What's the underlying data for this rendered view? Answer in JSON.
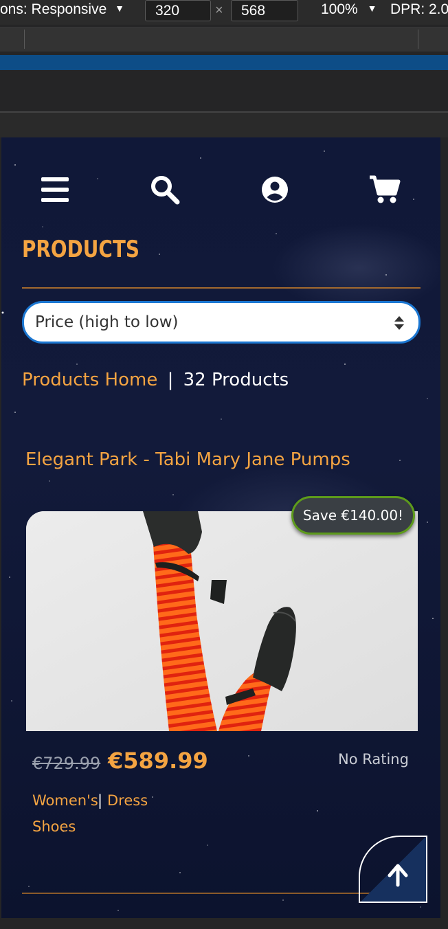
{
  "devtools": {
    "dimensions_label": "ons: Responsive",
    "width_value": "320",
    "height_value": "568",
    "times_symbol": "×",
    "zoom_label": "100%",
    "dpr_label": "DPR: 2.0"
  },
  "nav": {
    "icons": [
      "menu-icon",
      "search-icon",
      "user-icon",
      "cart-icon"
    ]
  },
  "page": {
    "title": "PRODUCTS",
    "sort_selected": "Price (high to low)",
    "breadcrumb_link": "Products Home",
    "breadcrumb_sep": "|",
    "product_count": "32 Products"
  },
  "product": {
    "name": "Elegant Park - Tabi Mary Jane Pumps",
    "save_label": "Save €140.00!",
    "old_price": "€729.99",
    "price": "€589.99",
    "rating": "No Rating",
    "category_1": "Women's",
    "category_sep": "|",
    "category_2_line1": "Dress",
    "category_2_line2": "Shoes"
  },
  "colors": {
    "accent": "#f4a442",
    "background": "#101838",
    "select_border": "#1b77d2",
    "badge_border": "#5d9b1b",
    "devtools_blue": "#0d4d87"
  }
}
